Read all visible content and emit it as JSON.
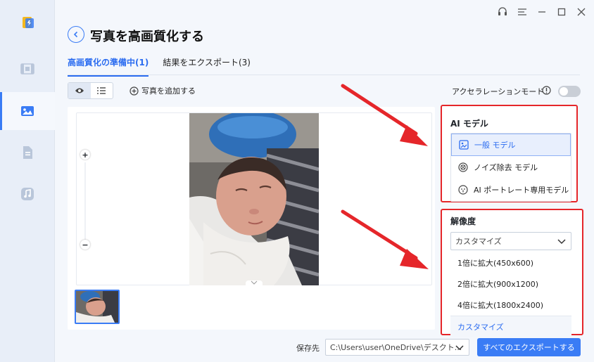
{
  "header": {
    "title": "写真を高画質化する"
  },
  "tabs": [
    {
      "label": "高画質化の準備中(1)",
      "active": true
    },
    {
      "label": "結果をエクスポート(3)",
      "active": false
    }
  ],
  "toolbar": {
    "add_photo_label": "写真を追加する",
    "accel_label": "アクセラレーションモード",
    "accel_on": false
  },
  "ai_panel": {
    "title": "AI モデル",
    "models": [
      {
        "label": "一般 モデル",
        "icon": "image-icon",
        "selected": true
      },
      {
        "label": "ノイズ除去 モデル",
        "icon": "noise-icon",
        "selected": false
      },
      {
        "label": "AI ポートレート専用モデル",
        "icon": "portrait-icon",
        "selected": false
      }
    ]
  },
  "resolution": {
    "title": "解像度",
    "selected": "カスタマイズ",
    "options": [
      {
        "label": "1倍に拡大(450x600)"
      },
      {
        "label": "2倍に拡大(900x1200)"
      },
      {
        "label": "4倍に拡大(1800x2400)"
      },
      {
        "label": "カスタマイズ"
      }
    ]
  },
  "footer": {
    "save_label": "保存先",
    "save_path": "C:\\Users\\user\\OneDrive\\デスクト...",
    "export_label": "すべてのエクスポートする"
  },
  "colors": {
    "accent": "#3a7cf5",
    "highlight": "#e5262a"
  }
}
